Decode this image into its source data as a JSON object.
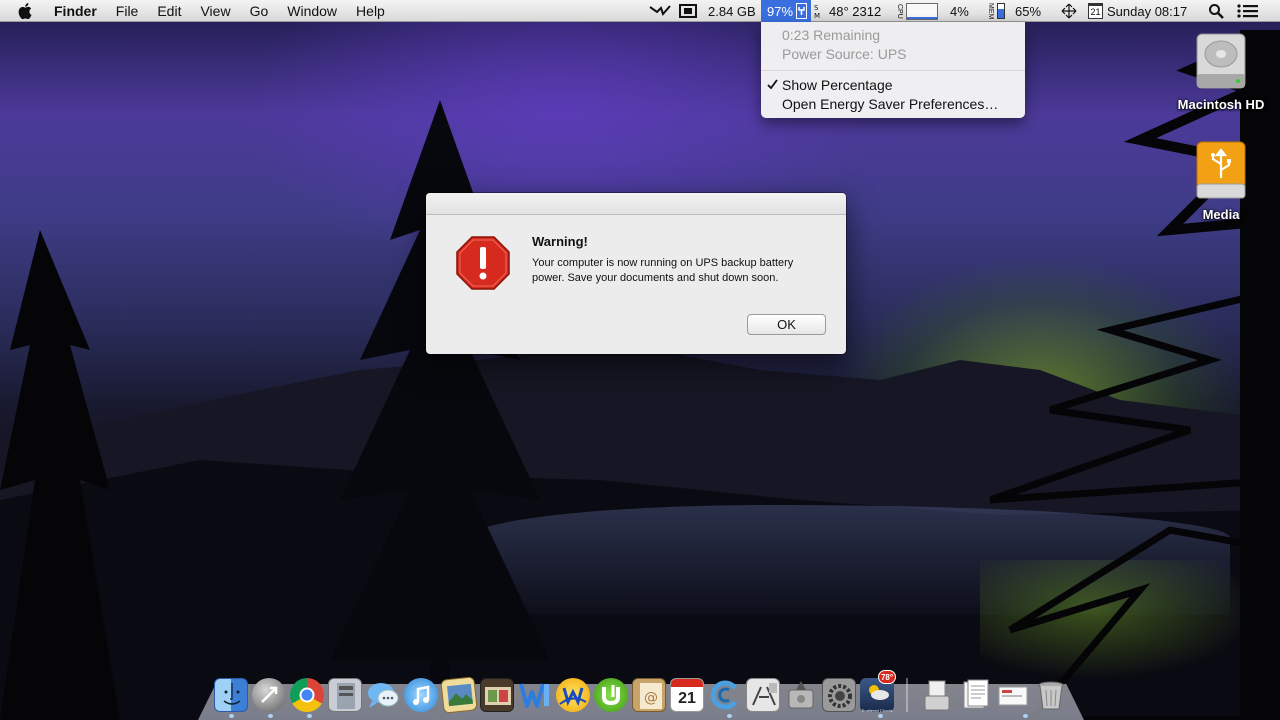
{
  "menubar": {
    "apple_icon": "apple-logo-icon",
    "app_name": "Finder",
    "items": [
      "File",
      "Edit",
      "View",
      "Go",
      "Window",
      "Help"
    ],
    "status": {
      "memory": "2.84 GB",
      "battery_percent": "97%",
      "temperature": "48° 2312",
      "cpu_label": "CPU",
      "cpu_percent": "4%",
      "mem_label": "MEM",
      "mem_percent": "65%",
      "calendar_day": "21",
      "clock": "Sunday 08:17"
    }
  },
  "battery_menu": {
    "remaining": "0:23 Remaining",
    "power_source": "Power Source: UPS",
    "show_percentage": "Show Percentage",
    "show_percentage_checked": true,
    "energy_saver": "Open Energy Saver Preferences…"
  },
  "desktop_icons": [
    {
      "label": "Macintosh HD",
      "icon": "hard-drive-icon"
    },
    {
      "label": "Media",
      "icon": "usb-drive-icon"
    }
  ],
  "alert": {
    "title": "Warning!",
    "message": "Your computer is now running on UPS backup battery power. Save your documents and shut down soon.",
    "ok_label": "OK",
    "icon": "stop-sign-icon"
  },
  "dock": {
    "apps": [
      "finder",
      "launchpad",
      "chrome",
      "mail-stamp",
      "messages",
      "itunes",
      "preview",
      "photo-booth",
      "word",
      "wireshark",
      "utorrent",
      "address-book",
      "calendar",
      "cloud-app",
      "file-editor",
      "disk-utility",
      "system-preferences",
      "weather"
    ],
    "calendar_day": "21",
    "weather_badge": "78°",
    "weather_caption": "Scattered Clouds",
    "stacks": [
      "documents",
      "downloads",
      "mail-stack",
      "trash"
    ]
  },
  "colors": {
    "menu_selection": "#3a6fe0",
    "stop_sign": "#d62a1e",
    "alert_bg": "#ececec"
  }
}
